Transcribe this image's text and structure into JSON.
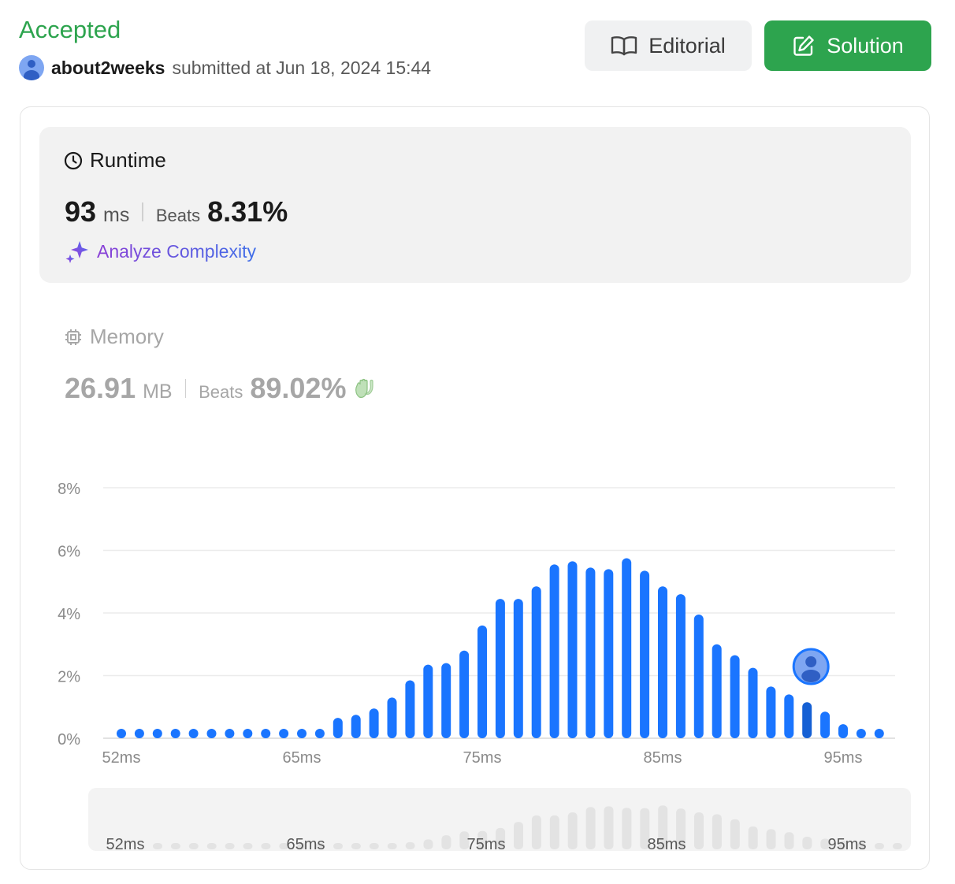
{
  "header": {
    "status": "Accepted",
    "username": "about2weeks",
    "submitted_text": "submitted at Jun 18, 2024 15:44"
  },
  "buttons": {
    "editorial": "Editorial",
    "solution": "Solution"
  },
  "runtime": {
    "label": "Runtime",
    "value": "93",
    "unit": "ms",
    "beats_label": "Beats",
    "beats_value": "8.31%",
    "analyze_label": "Analyze Complexity"
  },
  "memory": {
    "label": "Memory",
    "value": "26.91",
    "unit": "MB",
    "beats_label": "Beats",
    "beats_value": "89.02%"
  },
  "colors": {
    "accepted": "#2da44e",
    "bar": "#1a75ff",
    "bar_highlight": "#1560d4",
    "overview_bar": "#e3e3e3"
  },
  "chart_data": {
    "type": "bar",
    "y_ticks": [
      "8%",
      "6%",
      "4%",
      "2%",
      "0%"
    ],
    "ylim": [
      0,
      8
    ],
    "x_tick_labels": [
      "52ms",
      "65ms",
      "75ms",
      "85ms",
      "95ms"
    ],
    "x_tick_bar_index": [
      0,
      10,
      20,
      30,
      40
    ],
    "values": [
      0.2,
      0.2,
      0.2,
      0.2,
      0.2,
      0.2,
      0.2,
      0.2,
      0.2,
      0.2,
      0.25,
      0.3,
      0.65,
      0.75,
      0.95,
      1.3,
      1.85,
      2.35,
      2.4,
      2.8,
      3.6,
      4.45,
      4.45,
      4.85,
      5.55,
      5.65,
      5.45,
      5.4,
      5.75,
      5.35,
      4.85,
      4.6,
      3.95,
      3.0,
      2.65,
      2.25,
      1.65,
      1.4,
      1.15,
      0.85,
      0.45,
      0.3,
      0.2
    ],
    "highlight_index": 38,
    "grid": true,
    "overview_x_tick_labels": [
      "52ms",
      "65ms",
      "75ms",
      "85ms",
      "95ms"
    ]
  }
}
